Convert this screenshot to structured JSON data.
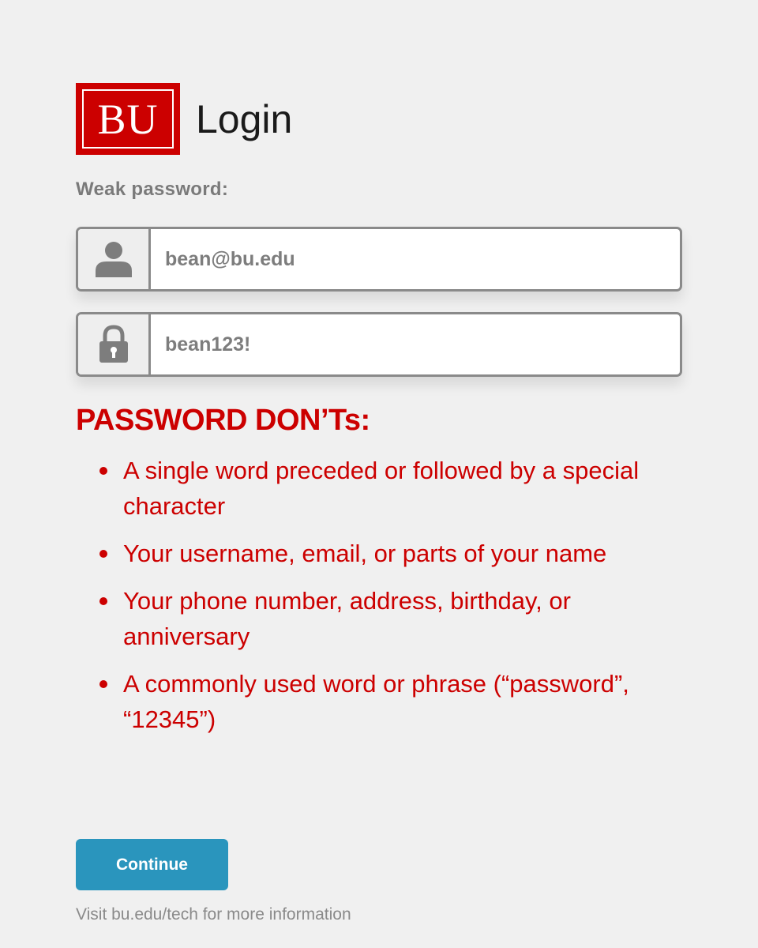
{
  "header": {
    "logo_text": "BU",
    "app_title": "Login"
  },
  "weak_label": "Weak password:",
  "fields": {
    "username": {
      "value": "bean@bu.edu",
      "icon": "user-icon"
    },
    "password": {
      "value": "bean123!",
      "icon": "lock-icon"
    }
  },
  "donts": {
    "title": "PASSWORD DON’Ts:",
    "items": [
      "A single word preceded or followed by a special character",
      "Your username, email, or parts of your name",
      "Your phone number, address, birthday, or anniversary",
      "A commonly used word or phrase (“password”, “12345”)"
    ]
  },
  "continue_label": "Continue",
  "footer_text": "Visit bu.edu/tech for more information",
  "colors": {
    "brand_red": "#cc0000",
    "button_blue": "#2a95bd",
    "background": "#f0f0f0"
  }
}
